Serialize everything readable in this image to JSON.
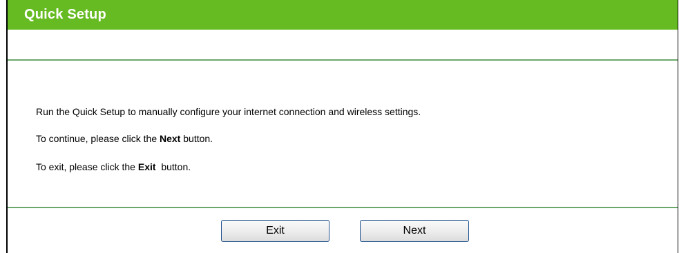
{
  "header": {
    "title": "Quick Setup"
  },
  "content": {
    "line1": "Run the Quick Setup to manually configure your internet connection and wireless settings.",
    "line2_prefix": "To continue, please click the ",
    "line2_bold": "Next",
    "line2_suffix": " button.",
    "line3_prefix": "To exit, please click the ",
    "line3_bold": "Exit",
    "line3_suffix": "  button."
  },
  "buttons": {
    "exit_label": "Exit",
    "next_label": "Next"
  },
  "colors": {
    "title_bar": "#66bb22",
    "divider": "#6aa86a",
    "button_border": "#1c4f8c"
  }
}
